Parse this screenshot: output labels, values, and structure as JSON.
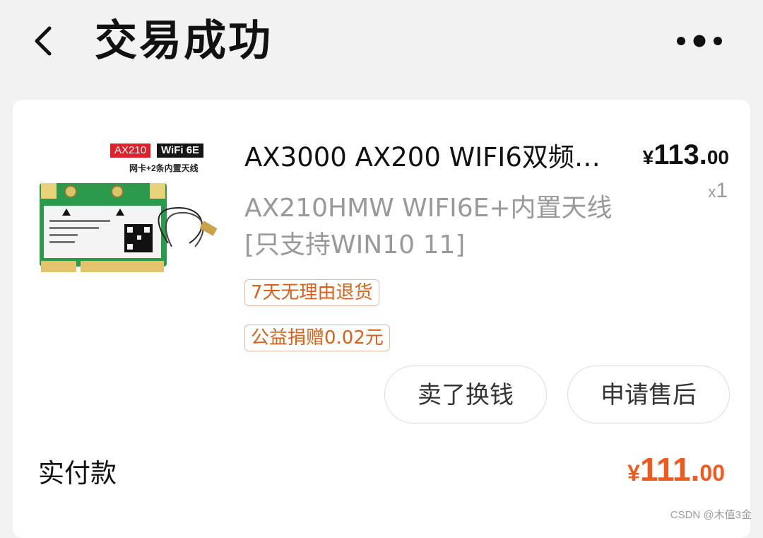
{
  "header": {
    "title": "交易成功",
    "back_icon": "chevron-left-icon",
    "more_icon": "more-dots-icon"
  },
  "product": {
    "image_tag_model": "AX210",
    "image_tag_wifi": "WiFi 6E",
    "image_caption": "网卡+2条内置天线",
    "title": "AX3000 AX200 WIFI6双频…",
    "spec": "AX210HMW WIFI6E+内置天线[只支持WIN10 11]",
    "price_symbol": "¥",
    "price_int": "113.",
    "price_dec": "00",
    "qty_prefix": "x",
    "qty": "1",
    "tags": [
      "7天无理由退货",
      "公益捐赠0.02元"
    ]
  },
  "actions": {
    "sell": "卖了换钱",
    "after_sale": "申请售后"
  },
  "payment": {
    "label": "实付款",
    "symbol": "¥",
    "amount_int": "111.",
    "amount_dec": "00"
  },
  "watermark": "CSDN @木值3金",
  "colors": {
    "accent": "#f2591c",
    "tag_text": "#d9621a",
    "tag_border": "#e7b999",
    "background": "#f2f2f2"
  }
}
